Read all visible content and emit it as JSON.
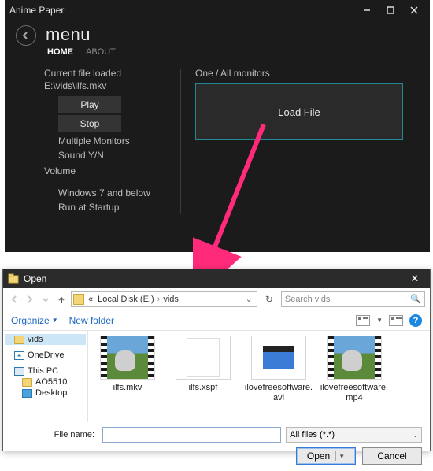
{
  "app": {
    "title": "Anime Paper",
    "menu_label": "menu",
    "tabs": {
      "home": "HOME",
      "about": "ABOUT"
    },
    "left": {
      "current_label": "Current file loaded",
      "current_path": "E:\\vids\\ilfs.mkv",
      "play": "Play",
      "stop": "Stop",
      "multi_monitors": "Multiple Monitors",
      "sound_yn": "Sound Y/N",
      "volume": "Volume",
      "win7_below": "Windows 7 and below",
      "run_startup": "Run at Startup"
    },
    "right": {
      "heading": "One / All monitors",
      "load_file": "Load File"
    }
  },
  "dlg": {
    "title": "Open",
    "crumbs": {
      "prefix": "«",
      "disk": "Local Disk (E:)",
      "folder": "vids"
    },
    "search_placeholder": "Search vids",
    "toolbar": {
      "organize": "Organize",
      "new_folder": "New folder"
    },
    "tree": {
      "vids": "vids",
      "onedrive": "OneDrive",
      "thispc": "This PC",
      "ao5510": "AO5510",
      "desktop": "Desktop"
    },
    "files": [
      {
        "name": "ilfs.mkv",
        "kind": "video-thumb"
      },
      {
        "name": "ilfs.xspf",
        "kind": "sheet"
      },
      {
        "name": "ilovefreesoftware.avi",
        "kind": "video-icon"
      },
      {
        "name": "ilovefreesoftware.mp4",
        "kind": "video-thumb"
      }
    ],
    "footer": {
      "filename_label": "File name:",
      "filter_label": "All files (*.*)",
      "open": "Open",
      "cancel": "Cancel"
    }
  }
}
